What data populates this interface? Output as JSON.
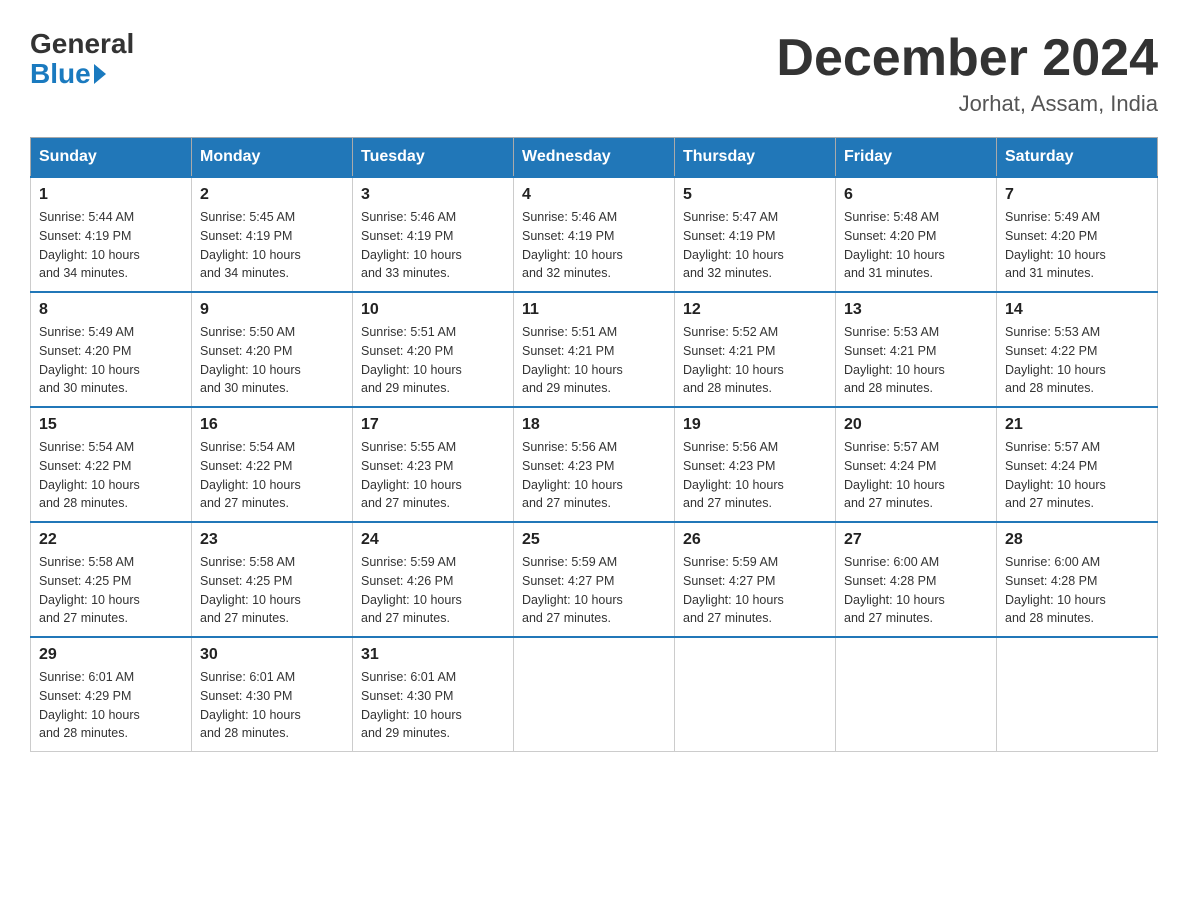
{
  "header": {
    "logo_general": "General",
    "logo_blue": "Blue",
    "month_year": "December 2024",
    "location": "Jorhat, Assam, India"
  },
  "days_of_week": [
    "Sunday",
    "Monday",
    "Tuesday",
    "Wednesday",
    "Thursday",
    "Friday",
    "Saturday"
  ],
  "weeks": [
    [
      {
        "day": "1",
        "info": "Sunrise: 5:44 AM\nSunset: 4:19 PM\nDaylight: 10 hours\nand 34 minutes."
      },
      {
        "day": "2",
        "info": "Sunrise: 5:45 AM\nSunset: 4:19 PM\nDaylight: 10 hours\nand 34 minutes."
      },
      {
        "day": "3",
        "info": "Sunrise: 5:46 AM\nSunset: 4:19 PM\nDaylight: 10 hours\nand 33 minutes."
      },
      {
        "day": "4",
        "info": "Sunrise: 5:46 AM\nSunset: 4:19 PM\nDaylight: 10 hours\nand 32 minutes."
      },
      {
        "day": "5",
        "info": "Sunrise: 5:47 AM\nSunset: 4:19 PM\nDaylight: 10 hours\nand 32 minutes."
      },
      {
        "day": "6",
        "info": "Sunrise: 5:48 AM\nSunset: 4:20 PM\nDaylight: 10 hours\nand 31 minutes."
      },
      {
        "day": "7",
        "info": "Sunrise: 5:49 AM\nSunset: 4:20 PM\nDaylight: 10 hours\nand 31 minutes."
      }
    ],
    [
      {
        "day": "8",
        "info": "Sunrise: 5:49 AM\nSunset: 4:20 PM\nDaylight: 10 hours\nand 30 minutes."
      },
      {
        "day": "9",
        "info": "Sunrise: 5:50 AM\nSunset: 4:20 PM\nDaylight: 10 hours\nand 30 minutes."
      },
      {
        "day": "10",
        "info": "Sunrise: 5:51 AM\nSunset: 4:20 PM\nDaylight: 10 hours\nand 29 minutes."
      },
      {
        "day": "11",
        "info": "Sunrise: 5:51 AM\nSunset: 4:21 PM\nDaylight: 10 hours\nand 29 minutes."
      },
      {
        "day": "12",
        "info": "Sunrise: 5:52 AM\nSunset: 4:21 PM\nDaylight: 10 hours\nand 28 minutes."
      },
      {
        "day": "13",
        "info": "Sunrise: 5:53 AM\nSunset: 4:21 PM\nDaylight: 10 hours\nand 28 minutes."
      },
      {
        "day": "14",
        "info": "Sunrise: 5:53 AM\nSunset: 4:22 PM\nDaylight: 10 hours\nand 28 minutes."
      }
    ],
    [
      {
        "day": "15",
        "info": "Sunrise: 5:54 AM\nSunset: 4:22 PM\nDaylight: 10 hours\nand 28 minutes."
      },
      {
        "day": "16",
        "info": "Sunrise: 5:54 AM\nSunset: 4:22 PM\nDaylight: 10 hours\nand 27 minutes."
      },
      {
        "day": "17",
        "info": "Sunrise: 5:55 AM\nSunset: 4:23 PM\nDaylight: 10 hours\nand 27 minutes."
      },
      {
        "day": "18",
        "info": "Sunrise: 5:56 AM\nSunset: 4:23 PM\nDaylight: 10 hours\nand 27 minutes."
      },
      {
        "day": "19",
        "info": "Sunrise: 5:56 AM\nSunset: 4:23 PM\nDaylight: 10 hours\nand 27 minutes."
      },
      {
        "day": "20",
        "info": "Sunrise: 5:57 AM\nSunset: 4:24 PM\nDaylight: 10 hours\nand 27 minutes."
      },
      {
        "day": "21",
        "info": "Sunrise: 5:57 AM\nSunset: 4:24 PM\nDaylight: 10 hours\nand 27 minutes."
      }
    ],
    [
      {
        "day": "22",
        "info": "Sunrise: 5:58 AM\nSunset: 4:25 PM\nDaylight: 10 hours\nand 27 minutes."
      },
      {
        "day": "23",
        "info": "Sunrise: 5:58 AM\nSunset: 4:25 PM\nDaylight: 10 hours\nand 27 minutes."
      },
      {
        "day": "24",
        "info": "Sunrise: 5:59 AM\nSunset: 4:26 PM\nDaylight: 10 hours\nand 27 minutes."
      },
      {
        "day": "25",
        "info": "Sunrise: 5:59 AM\nSunset: 4:27 PM\nDaylight: 10 hours\nand 27 minutes."
      },
      {
        "day": "26",
        "info": "Sunrise: 5:59 AM\nSunset: 4:27 PM\nDaylight: 10 hours\nand 27 minutes."
      },
      {
        "day": "27",
        "info": "Sunrise: 6:00 AM\nSunset: 4:28 PM\nDaylight: 10 hours\nand 27 minutes."
      },
      {
        "day": "28",
        "info": "Sunrise: 6:00 AM\nSunset: 4:28 PM\nDaylight: 10 hours\nand 28 minutes."
      }
    ],
    [
      {
        "day": "29",
        "info": "Sunrise: 6:01 AM\nSunset: 4:29 PM\nDaylight: 10 hours\nand 28 minutes."
      },
      {
        "day": "30",
        "info": "Sunrise: 6:01 AM\nSunset: 4:30 PM\nDaylight: 10 hours\nand 28 minutes."
      },
      {
        "day": "31",
        "info": "Sunrise: 6:01 AM\nSunset: 4:30 PM\nDaylight: 10 hours\nand 29 minutes."
      },
      {
        "day": "",
        "info": ""
      },
      {
        "day": "",
        "info": ""
      },
      {
        "day": "",
        "info": ""
      },
      {
        "day": "",
        "info": ""
      }
    ]
  ]
}
